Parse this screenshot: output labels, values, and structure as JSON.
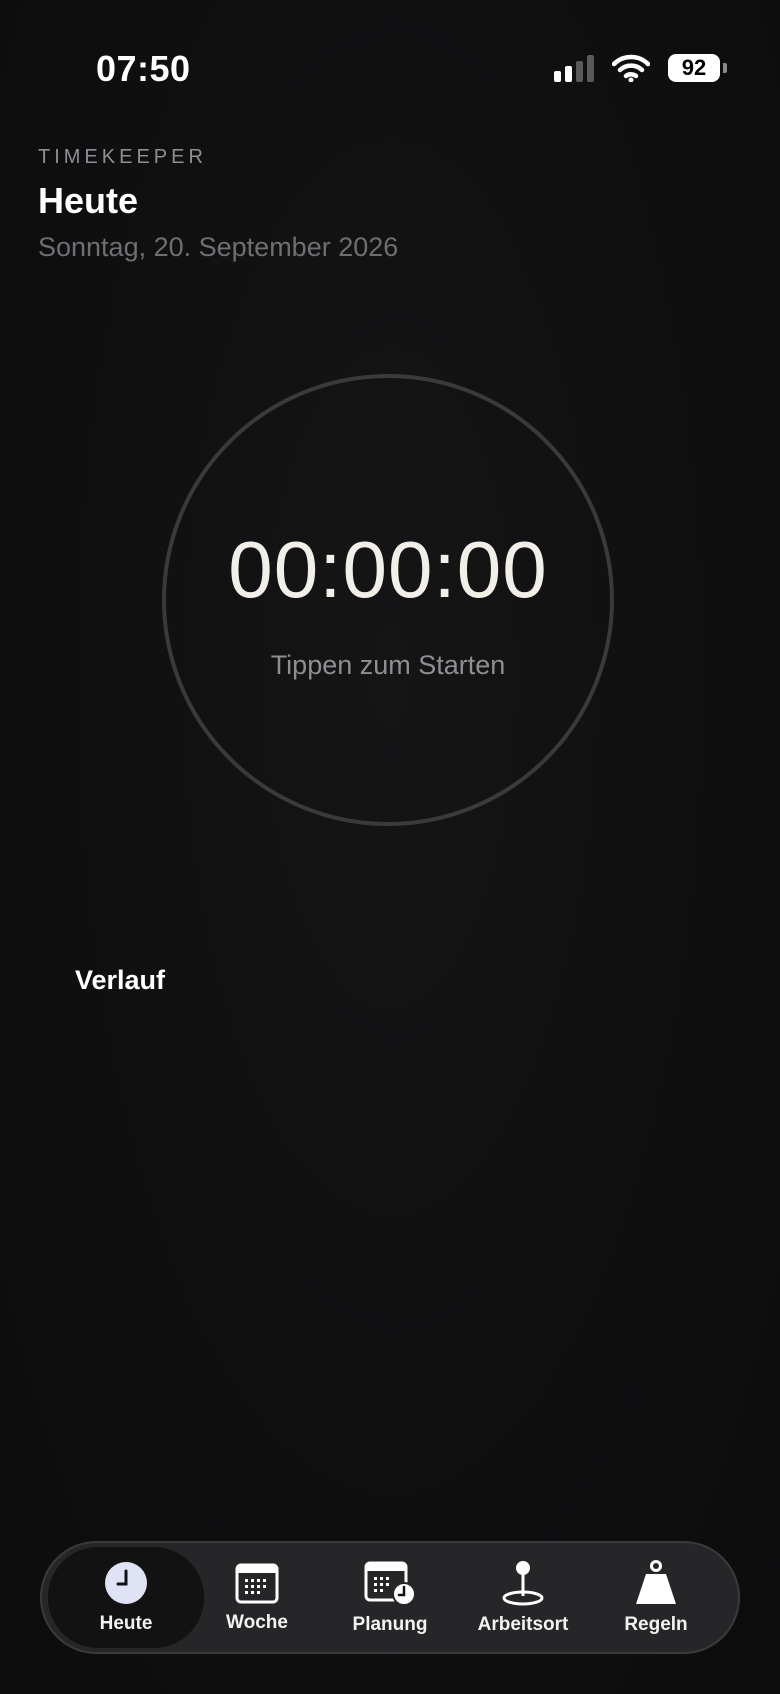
{
  "status_bar": {
    "time": "07:50",
    "battery": "92",
    "icons": [
      "cellular-signal-icon",
      "wifi-icon",
      "battery-icon"
    ]
  },
  "header": {
    "app_name": "TIMEKEEPER",
    "title": "Heute",
    "date": "Sonntag, 20. September 2026"
  },
  "timer": {
    "value": "00:00:00",
    "hint": "Tippen zum Starten"
  },
  "history": {
    "title": "Verlauf"
  },
  "tabbar": {
    "active": "Heute",
    "tabs": [
      {
        "label": "Heute",
        "icon": "clock-icon"
      },
      {
        "label": "Woche",
        "icon": "calendar-icon"
      },
      {
        "label": "Planung",
        "icon": "calendar-clock-icon"
      },
      {
        "label": "Arbeitsort",
        "icon": "location-pin-icon"
      },
      {
        "label": "Regeln",
        "icon": "weight-icon"
      }
    ]
  },
  "colors": {
    "background": "#0f0f10",
    "text_primary": "#ffffff",
    "text_secondary": "#8e8e93",
    "ring": "#3a3a3c",
    "tabbar": "#262628"
  }
}
